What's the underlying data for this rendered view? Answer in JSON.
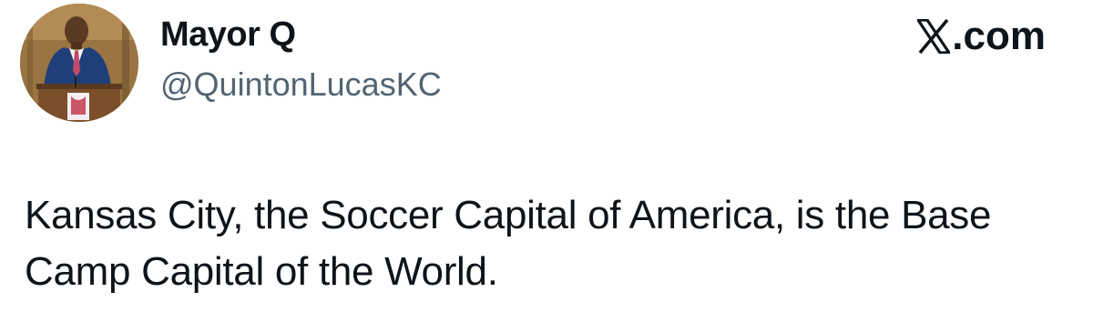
{
  "author": {
    "display_name": "Mayor Q",
    "handle": "@QuintonLucasKC",
    "avatar_icon": "profile-photo-at-podium"
  },
  "source": {
    "logo_icon": "x-logo",
    "domain_suffix": ".com"
  },
  "tweet": {
    "text": "Kansas City, the Soccer Capital of America, is the Base Camp Capital of the World."
  },
  "colors": {
    "text_primary": "#0f1419",
    "text_secondary": "#536471",
    "background": "#ffffff"
  }
}
